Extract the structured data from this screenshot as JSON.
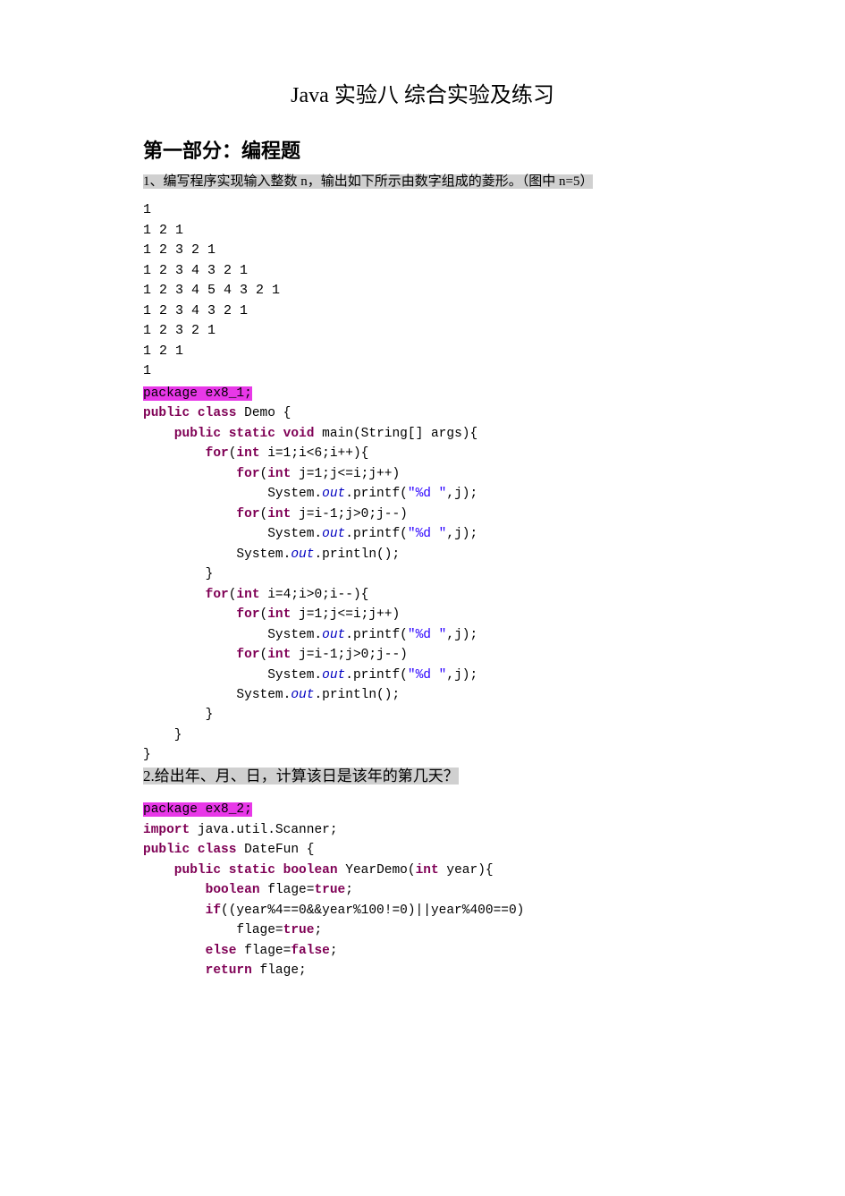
{
  "title": "Java 实验八 综合实验及练习",
  "section_heading": "第一部分：编程题",
  "q1_text": "1、编写程序实现输入整数 n，输出如下所示由数字组成的菱形。（图中 n=5）",
  "output_diamond": "1\n1 2 1\n1 2 3 2 1\n1 2 3 4 3 2 1\n1 2 3 4 5 4 3 2 1\n1 2 3 4 3 2 1\n1 2 3 2 1\n1 2 1\n1",
  "code1": {
    "pkg": "package ex8_1;",
    "l1a": "public",
    "l1b": " class",
    "l1c": " Demo {",
    "l2a": "    public",
    "l2b": " static",
    "l2c": " void",
    "l2d": " main(String[] args){",
    "l3a": "        for",
    "l3b": "(",
    "l3c": "int",
    "l3d": " i=1;i<6;i++){",
    "l4a": "            for",
    "l4b": "(",
    "l4c": "int",
    "l4d": " j=1;j<=i;j++)",
    "l5a": "                System.",
    "l5b": "out",
    "l5c": ".printf(",
    "l5d": "\"%d \"",
    "l5e": ",j);",
    "l6a": "            for",
    "l6b": "(",
    "l6c": "int",
    "l6d": " j=i-1;j>0;j--)",
    "l7a": "                System.",
    "l7b": "out",
    "l7c": ".printf(",
    "l7d": "\"%d \"",
    "l7e": ",j);",
    "l8a": "            System.",
    "l8b": "out",
    "l8c": ".println();",
    "l9": "        }",
    "l10a": "        for",
    "l10b": "(",
    "l10c": "int",
    "l10d": " i=4;i>0;i--){",
    "l11a": "            for",
    "l11b": "(",
    "l11c": "int",
    "l11d": " j=1;j<=i;j++)",
    "l12a": "                System.",
    "l12b": "out",
    "l12c": ".printf(",
    "l12d": "\"%d \"",
    "l12e": ",j);",
    "l13a": "            for",
    "l13b": "(",
    "l13c": "int",
    "l13d": " j=i-1;j>0;j--)",
    "l14a": "                System.",
    "l14b": "out",
    "l14c": ".printf(",
    "l14d": "\"%d \"",
    "l14e": ",j);",
    "l15a": "            System.",
    "l15b": "out",
    "l15c": ".println();",
    "l16": "        }",
    "l17": "    }",
    "l18": "}"
  },
  "q2_text": "2.给出年、月、日，计算该日是该年的第几天？",
  "code2": {
    "pkg": "package ex8_2;",
    "l1a": "import",
    "l1b": " java.util.Scanner;",
    "l2a": "public",
    "l2b": " class",
    "l2c": " DateFun {",
    "l3a": "    public",
    "l3b": " static",
    "l3c": " boolean",
    "l3d": " YearDemo(",
    "l3e": "int",
    "l3f": " year){",
    "l4a": "        boolean",
    "l4b": " flage=",
    "l4c": "true",
    "l4d": ";",
    "l5a": "        if",
    "l5b": "((year%4==0&&year%100!=0)||year%400==0)",
    "l6a": "            flage=",
    "l6b": "true",
    "l6c": ";",
    "l7a": "        else",
    "l7b": " flage=",
    "l7c": "false",
    "l7d": ";",
    "l8a": "        return",
    "l8b": " flage;"
  }
}
